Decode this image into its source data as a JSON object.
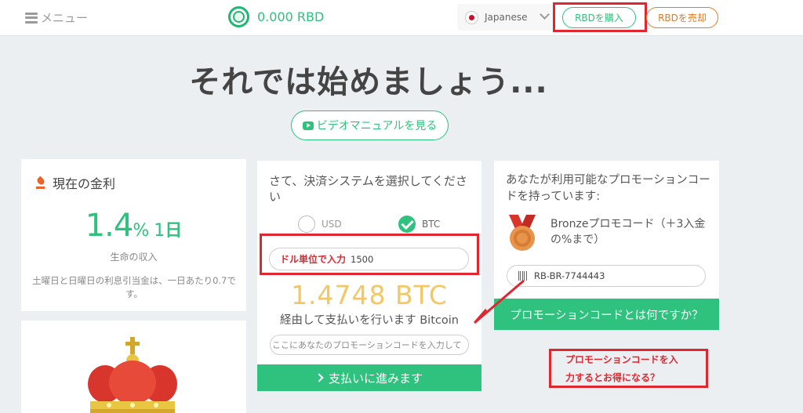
{
  "header": {
    "menu_label": "メニュー",
    "balance": "0.000 RBD",
    "language": "Japanese",
    "buy_label": "RBDを購入",
    "sell_label": "RBDを売却"
  },
  "main": {
    "title": "それでは始めましょう...",
    "video_label": "ビデオマニュアルを見る"
  },
  "interest_card": {
    "heading": "現在の金利",
    "rate_value": "1.4",
    "rate_unit": "%",
    "rate_period_num": "1",
    "rate_period_unit": "日",
    "subtitle": "生命の収入",
    "note": "土曜日と日曜日の利息引当金は、一日あたり0.7です。"
  },
  "payment_card": {
    "heading": "さて、決済システムを選択してください",
    "options": [
      "USD",
      "BTC"
    ],
    "selected": "BTC",
    "amount_label": "ドル単位で入力",
    "amount_value": "1500",
    "btc_amount": "1.4748 BTC",
    "via_text": "経由して支払いを行います Bitcoin",
    "promo_placeholder": "ここにあなたのプロモーションコードを入力して",
    "pay_button": "支払いに進みます"
  },
  "promo_card": {
    "heading": "あなたが利用可能なプロモーションコードを持っています:",
    "bronze_text": "Bronzeプロモコード（＋3入金の%まで）",
    "code": "RB-BR-7744443",
    "what_button": "プロモーションコードとは何ですか？"
  },
  "annotation": {
    "line1": "プロモーションコードを入",
    "line2": "力するとお得になる？"
  },
  "colors": {
    "accent": "#2ec27e",
    "sell": "#e07c2d",
    "highlight": "#e0262f",
    "btc_amount": "#f3c766"
  }
}
